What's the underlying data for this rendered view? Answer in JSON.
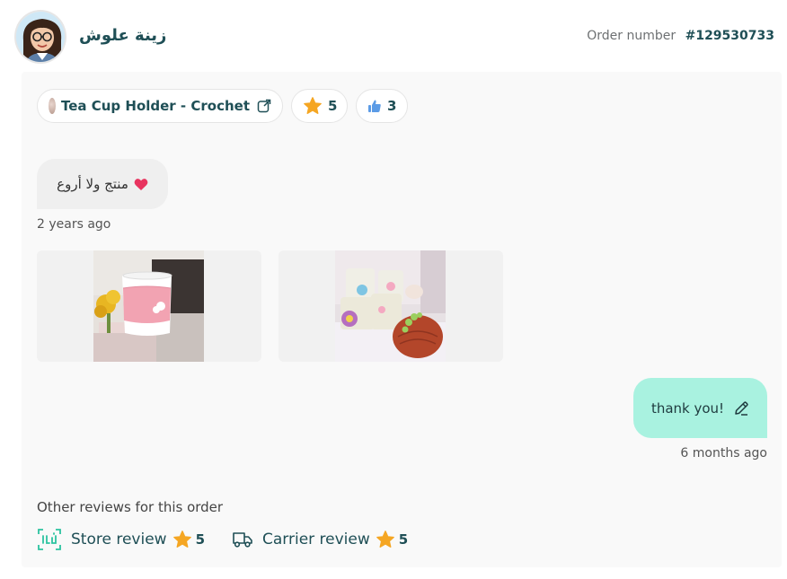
{
  "header": {
    "user_name": "زينة علوش",
    "order_label": "Order number",
    "order_number": "#129530733"
  },
  "product_chip": {
    "name": "Tea Cup Holder - Crochet",
    "link_icon": "external-link-icon"
  },
  "rating_chip": {
    "value": "5",
    "icon": "star-icon"
  },
  "likes_chip": {
    "value": "3",
    "icon": "thumbs-up-icon"
  },
  "customer_message": {
    "text": "منتج ولا أروع",
    "emoji_icon": "heart-icon",
    "time": "2 years ago"
  },
  "images": [
    {
      "name": "review-photo-1"
    },
    {
      "name": "review-photo-2"
    }
  ],
  "reply": {
    "text": "thank you!",
    "edit_icon": "pencil-icon",
    "time": "6 months ago"
  },
  "other_reviews": {
    "title": "Other reviews for this order",
    "store": {
      "label": "Store review",
      "rating": "5",
      "icon": "store-logo-icon"
    },
    "carrier": {
      "label": "Carrier review",
      "rating": "5",
      "icon": "truck-icon"
    }
  },
  "colors": {
    "accent_text": "#1f4f56",
    "reply_bubble": "#a9f2e0",
    "star": "#f5a623",
    "brand_teal": "#2cc3a0"
  }
}
